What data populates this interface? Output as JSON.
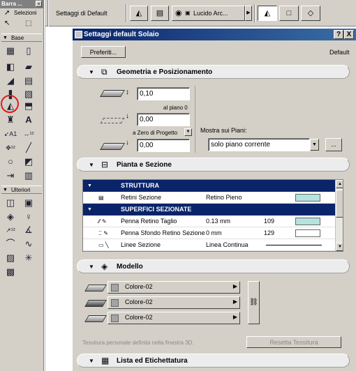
{
  "palette": {
    "title": "Barra ...",
    "close": "×",
    "select_label": "Selezioni",
    "section_base": "Base",
    "section_more": "Ulteriori"
  },
  "toolbar": {
    "default_label": "Settaggi di Default",
    "layer_label": "Lucido Arc..."
  },
  "dialog": {
    "title": "Settaggi default Solaio",
    "help": "?",
    "close": "X",
    "favorites_button": "Preferiti...",
    "default_text": "Default"
  },
  "geometry": {
    "header": "Geometria e Posizionamento",
    "thickness_value": "0,10",
    "to_floor_label": "al piano 0",
    "offset_value": "0,00",
    "to_project_zero_label": "a Zero di Progetto",
    "project_zero_value": "0,00",
    "show_on_floors_label": "Mostra sui Piani:",
    "show_on_floors_value": "solo piano corrente",
    "more_button": "..."
  },
  "plan": {
    "header": "Pianta e Sezione",
    "rows": [
      {
        "name": "STRUTTURA",
        "value": "",
        "num": "",
        "kind": "group"
      },
      {
        "name": "Retini Sezione",
        "value": "Retino Pieno",
        "num": "",
        "kind": "row",
        "swatch": "#b6e3de"
      },
      {
        "name": "SUPERFICI SEZIONATE",
        "value": "",
        "num": "",
        "kind": "group"
      },
      {
        "name": "Penna Retino Taglio",
        "value": "0.13 mm",
        "num": "109",
        "kind": "row",
        "swatch": "#b6e3de"
      },
      {
        "name": "Penna Sfondo Retino Sezione",
        "value": "0 mm",
        "num": "129",
        "kind": "row",
        "swatch": "#ffffff"
      },
      {
        "name": "Linee Sezione",
        "value": "Linea Continua",
        "num": "",
        "kind": "row",
        "swatch": ""
      }
    ]
  },
  "model": {
    "header": "Modello",
    "materials": [
      "Colore-02",
      "Colore-02",
      "Colore-02"
    ],
    "texture_note": "Tessitura personale definita nella finestra 3D.",
    "reset_texture_button": "Resetta Tessitura"
  },
  "listing": {
    "header": "Lista ed Etichettatura"
  }
}
